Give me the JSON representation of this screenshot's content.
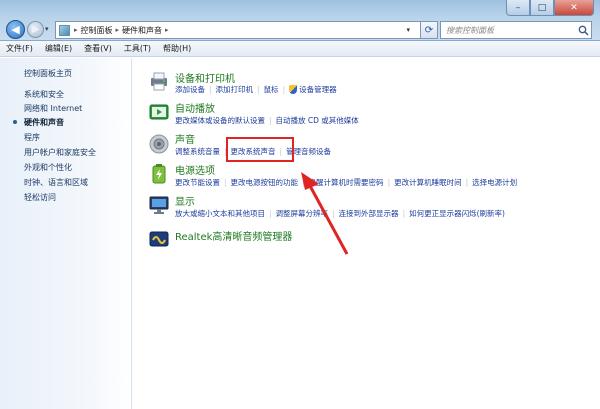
{
  "window": {
    "minimize_glyph": "–",
    "maximize_glyph": "□",
    "close_glyph": "✕"
  },
  "navigation": {
    "back_glyph": "◀",
    "forward_glyph": "▶",
    "history_glyph": "▾",
    "breadcrumb": [
      "控制面板",
      "硬件和声音"
    ],
    "breadcrumb_sep": "▸",
    "dropdown_glyph": "▾",
    "refresh_glyph": "⟳",
    "search_placeholder": "搜索控制面板"
  },
  "menubar": [
    "文件(F)",
    "编辑(E)",
    "查看(V)",
    "工具(T)",
    "帮助(H)"
  ],
  "sidebar": {
    "items": [
      {
        "label": "控制面板主页",
        "active": false
      },
      {
        "label": "系统和安全",
        "active": false
      },
      {
        "label": "网络和 Internet",
        "active": false
      },
      {
        "label": "硬件和声音",
        "active": true
      },
      {
        "label": "程序",
        "active": false
      },
      {
        "label": "用户帐户和家庭安全",
        "active": false
      },
      {
        "label": "外观和个性化",
        "active": false
      },
      {
        "label": "时钟、语言和区域",
        "active": false
      },
      {
        "label": "轻松访问",
        "active": false
      }
    ]
  },
  "categories": [
    {
      "icon": "printer-icon",
      "title": "设备和打印机",
      "links": [
        "添加设备",
        "添加打印机",
        "鼠标",
        "设备管理器"
      ]
    },
    {
      "icon": "autoplay-icon",
      "title": "自动播放",
      "links": [
        "更改媒体或设备的默认设置",
        "自动播放 CD 或其他媒体"
      ]
    },
    {
      "icon": "speaker-icon",
      "title": "声音",
      "links": [
        "调整系统音量",
        "更改系统声音",
        "管理音频设备"
      ]
    },
    {
      "icon": "power-icon",
      "title": "电源选项",
      "links": [
        "更改节能设置",
        "更改电源按钮的功能",
        "唤醒计算机时需要密码",
        "更改计算机睡眠时间",
        "选择电源计划"
      ]
    },
    {
      "icon": "display-icon",
      "title": "显示",
      "links": [
        "放大或缩小文本和其他项目",
        "调整屏幕分辨率",
        "连接到外部显示器",
        "如何更正显示器闪烁(刷新率)"
      ]
    },
    {
      "icon": "realtek-icon",
      "title": "Realtek高清晰音频管理器",
      "links": []
    }
  ],
  "colors": {
    "category_title": "#1f7a1f",
    "link": "#1e3d9c",
    "highlight_box": "#e02424",
    "arrow": "#e02424"
  }
}
